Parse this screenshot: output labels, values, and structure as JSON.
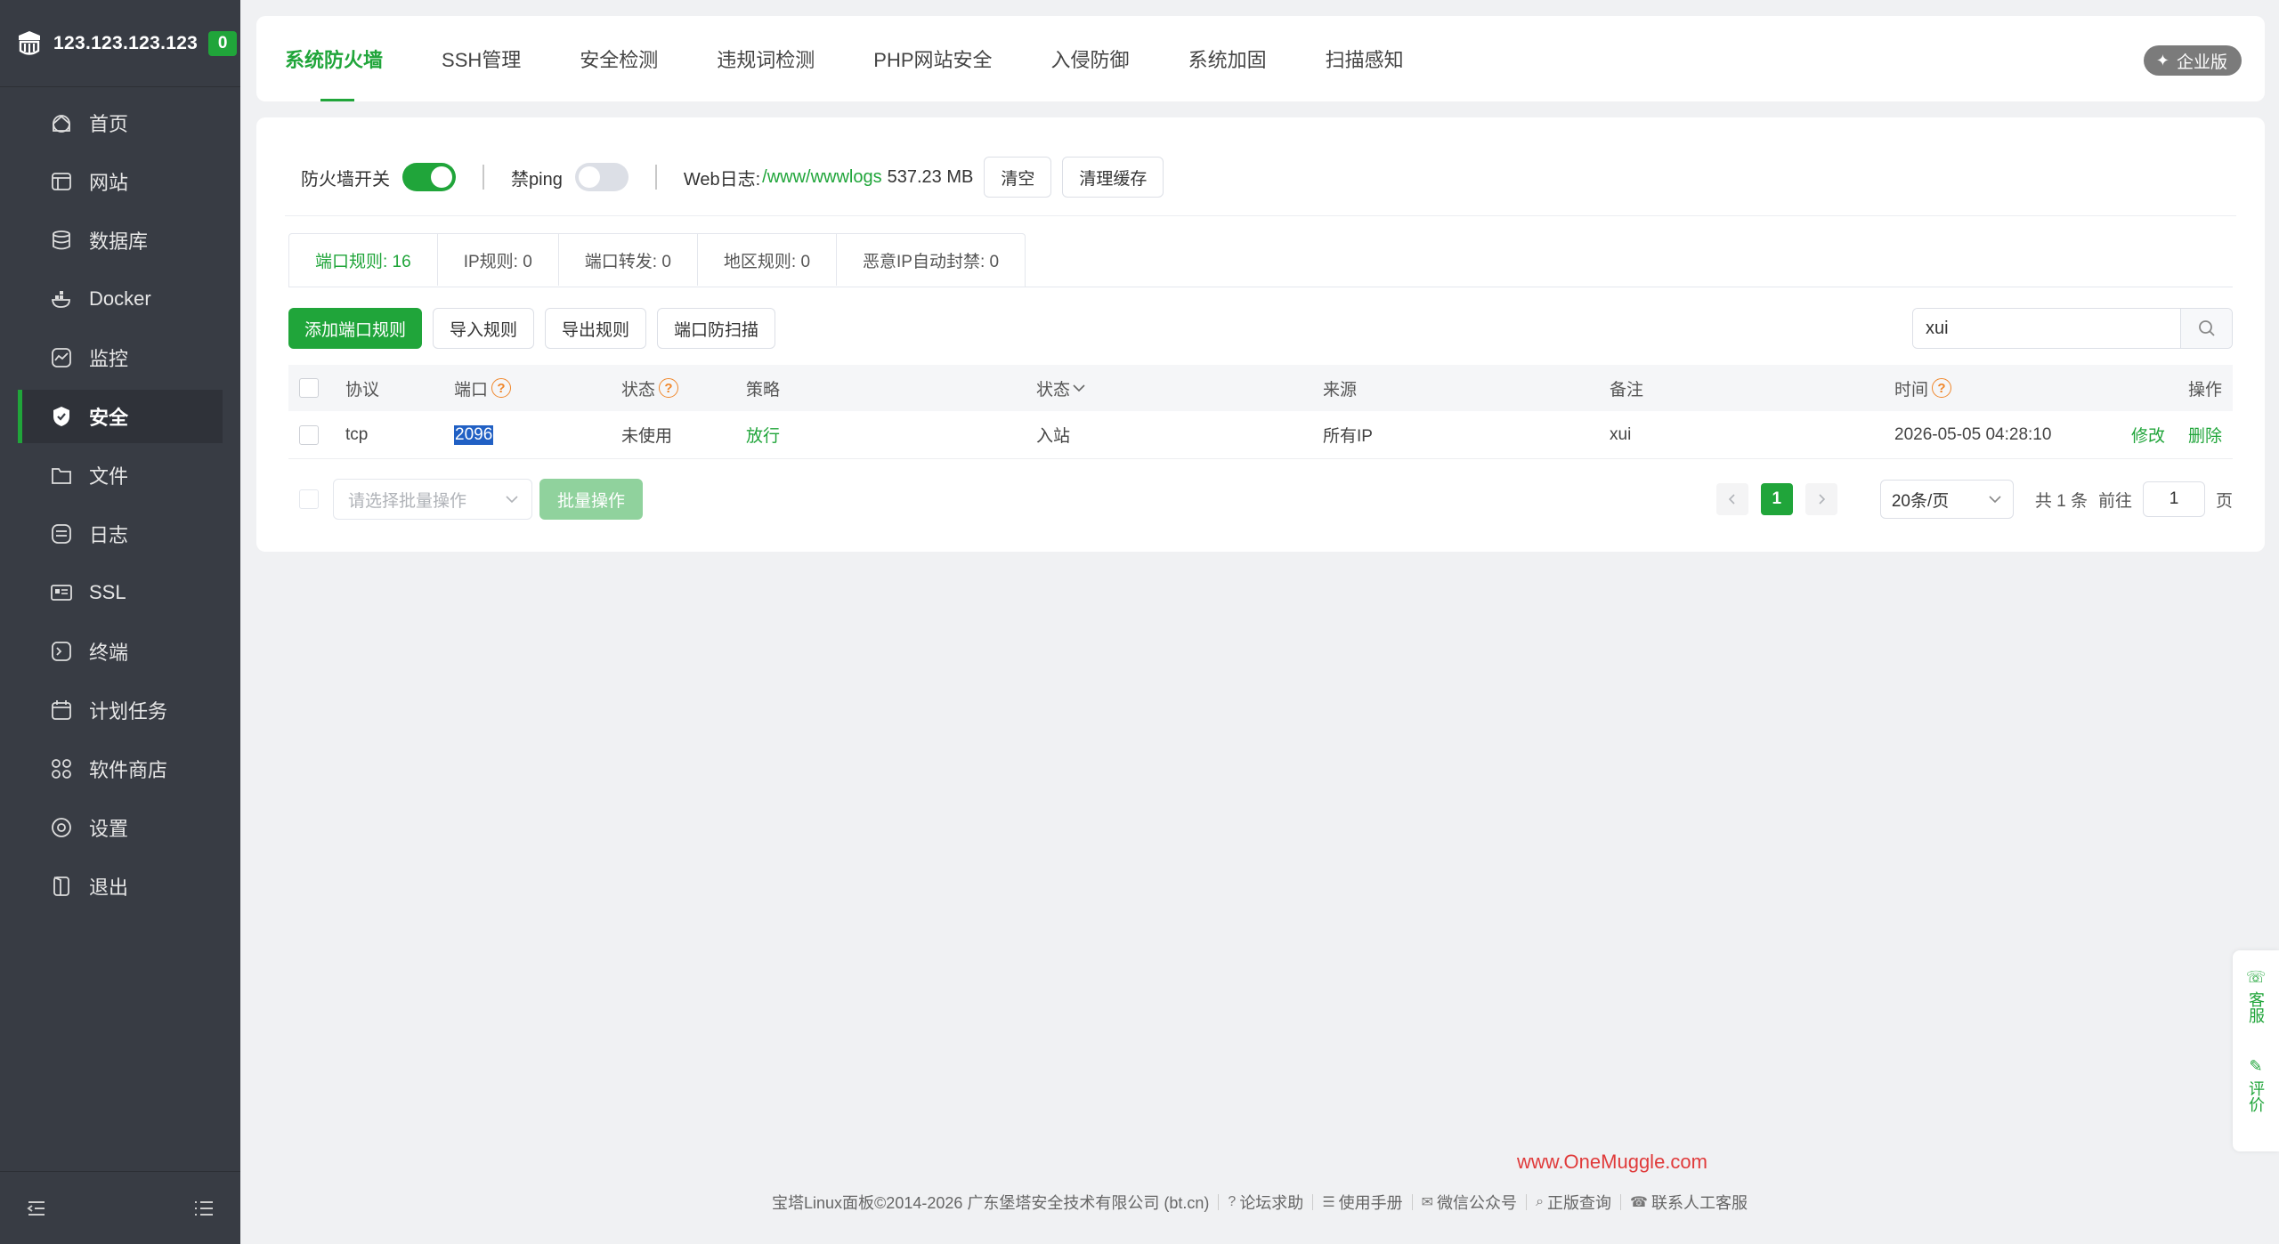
{
  "sidebar": {
    "server_ip": "123.123.123.123",
    "badge_count": "0",
    "items": [
      {
        "label": "首页",
        "icon": "home-icon"
      },
      {
        "label": "网站",
        "icon": "website-icon"
      },
      {
        "label": "数据库",
        "icon": "database-icon"
      },
      {
        "label": "Docker",
        "icon": "docker-icon"
      },
      {
        "label": "监控",
        "icon": "monitor-icon"
      },
      {
        "label": "安全",
        "icon": "shield-icon"
      },
      {
        "label": "文件",
        "icon": "folder-icon"
      },
      {
        "label": "日志",
        "icon": "log-icon"
      },
      {
        "label": "SSL",
        "icon": "ssl-icon"
      },
      {
        "label": "终端",
        "icon": "terminal-icon"
      },
      {
        "label": "计划任务",
        "icon": "calendar-icon"
      },
      {
        "label": "软件商店",
        "icon": "apps-icon"
      },
      {
        "label": "设置",
        "icon": "settings-icon"
      },
      {
        "label": "退出",
        "icon": "logout-icon"
      }
    ],
    "active_index": 5
  },
  "top_tabs": [
    "系统防火墙",
    "SSH管理",
    "安全检测",
    "违规词检测",
    "PHP网站安全",
    "入侵防御",
    "系统加固",
    "扫描感知"
  ],
  "enterprise_label": "企业版",
  "toolbar": {
    "firewall_label": "防火墙开关",
    "firewall_on": true,
    "ping_label": "禁ping",
    "ping_on": false,
    "weblog_label": "Web日志:",
    "weblog_path": "/www/wwwlogs",
    "weblog_size": "537.23 MB",
    "clear_label": "清空",
    "clear_cache_label": "清理缓存"
  },
  "sub_tabs": [
    {
      "label": "端口规则:  16"
    },
    {
      "label": "IP规则:  0"
    },
    {
      "label": "端口转发:  0"
    },
    {
      "label": "地区规则:  0"
    },
    {
      "label": "恶意IP自动封禁:  0"
    }
  ],
  "actions": {
    "add": "添加端口规则",
    "import": "导入规则",
    "export": "导出规则",
    "scan": "端口防扫描"
  },
  "search": {
    "value": "xui"
  },
  "table": {
    "headers": {
      "protocol": "协议",
      "port": "端口",
      "status": "状态",
      "policy": "策略",
      "direction": "状态",
      "source": "来源",
      "remark": "备注",
      "time": "时间",
      "ops": "操作"
    },
    "rows": [
      {
        "protocol": "tcp",
        "port": "2096",
        "status": "未使用",
        "policy": "放行",
        "direction": "入站",
        "source": "所有IP",
        "remark": "xui",
        "time": "2026-05-05 04:28:10",
        "edit": "修改",
        "delete": "删除"
      }
    ]
  },
  "footer_bar": {
    "batch_placeholder": "请选择批量操作",
    "batch_button": "批量操作",
    "current_page": "1",
    "page_size": "20条/页",
    "total": "共 1 条",
    "goto_label": "前往",
    "goto_value": "1",
    "page_unit": "页"
  },
  "watermark": "www.OneMuggle.com",
  "footer": {
    "copyright": "宝塔Linux面板©2014-2026 广东堡塔安全技术有限公司 (bt.cn)",
    "links": [
      {
        "label": "论坛求助",
        "icon": "help-icon"
      },
      {
        "label": "使用手册",
        "icon": "book-icon"
      },
      {
        "label": "微信公众号",
        "icon": "wechat-icon"
      },
      {
        "label": "正版查询",
        "icon": "verify-icon"
      },
      {
        "label": "联系人工客服",
        "icon": "service-icon"
      }
    ]
  },
  "floater": {
    "service": "客服",
    "review": "评价"
  },
  "colors": {
    "brand": "#20a53a",
    "sidebar": "#383c44",
    "warning": "#f0872b"
  }
}
